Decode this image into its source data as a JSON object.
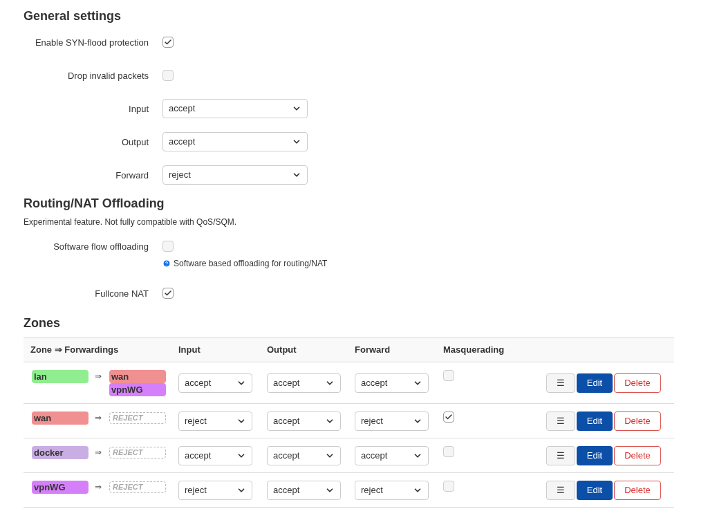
{
  "general": {
    "title": "General settings",
    "rows": [
      {
        "kind": "checkbox",
        "label": "Enable SYN-flood protection",
        "checked": true
      },
      {
        "kind": "checkbox",
        "label": "Drop invalid packets",
        "checked": false
      },
      {
        "kind": "select",
        "label": "Input",
        "value": "accept"
      },
      {
        "kind": "select",
        "label": "Output",
        "value": "accept"
      },
      {
        "kind": "select",
        "label": "Forward",
        "value": "reject"
      }
    ]
  },
  "offloading": {
    "title": "Routing/NAT Offloading",
    "description": "Experimental feature. Not fully compatible with QoS/SQM.",
    "rows": [
      {
        "kind": "checkbox",
        "label": "Software flow offloading",
        "checked": false,
        "help": "Software based offloading for routing/NAT"
      },
      {
        "kind": "checkbox",
        "label": "Fullcone NAT",
        "checked": true
      }
    ]
  },
  "zones": {
    "title": "Zones",
    "columns": [
      "Zone ⇒ Forwardings",
      "Input",
      "Output",
      "Forward",
      "Masquerading"
    ],
    "rows": [
      {
        "name": "lan",
        "color": "#90ee90",
        "arrow": "⇒",
        "forwardings": [
          {
            "name": "wan",
            "color": "#f09090"
          },
          {
            "name": "vpnWG",
            "color": "#d580fa"
          }
        ],
        "input": "accept",
        "output": "accept",
        "forward": "accept",
        "masquerading": false,
        "menu_symbol": "☰",
        "edit_label": "Edit",
        "delete_label": "Delete"
      },
      {
        "name": "wan",
        "color": "#f09090",
        "arrow": "⇒",
        "forwardings": [],
        "none_label": "REJECT",
        "input": "reject",
        "output": "accept",
        "forward": "reject",
        "masquerading": true,
        "menu_symbol": "☰",
        "edit_label": "Edit",
        "delete_label": "Delete"
      },
      {
        "name": "docker",
        "color": "#c9aee3",
        "arrow": "⇒",
        "forwardings": [],
        "none_label": "REJECT",
        "input": "accept",
        "output": "accept",
        "forward": "accept",
        "masquerading": false,
        "menu_symbol": "☰",
        "edit_label": "Edit",
        "delete_label": "Delete"
      },
      {
        "name": "vpnWG",
        "color": "#d580fa",
        "arrow": "⇒",
        "forwardings": [],
        "none_label": "REJECT",
        "input": "reject",
        "output": "accept",
        "forward": "reject",
        "masquerading": false,
        "menu_symbol": "☰",
        "edit_label": "Edit",
        "delete_label": "Delete"
      }
    ]
  }
}
